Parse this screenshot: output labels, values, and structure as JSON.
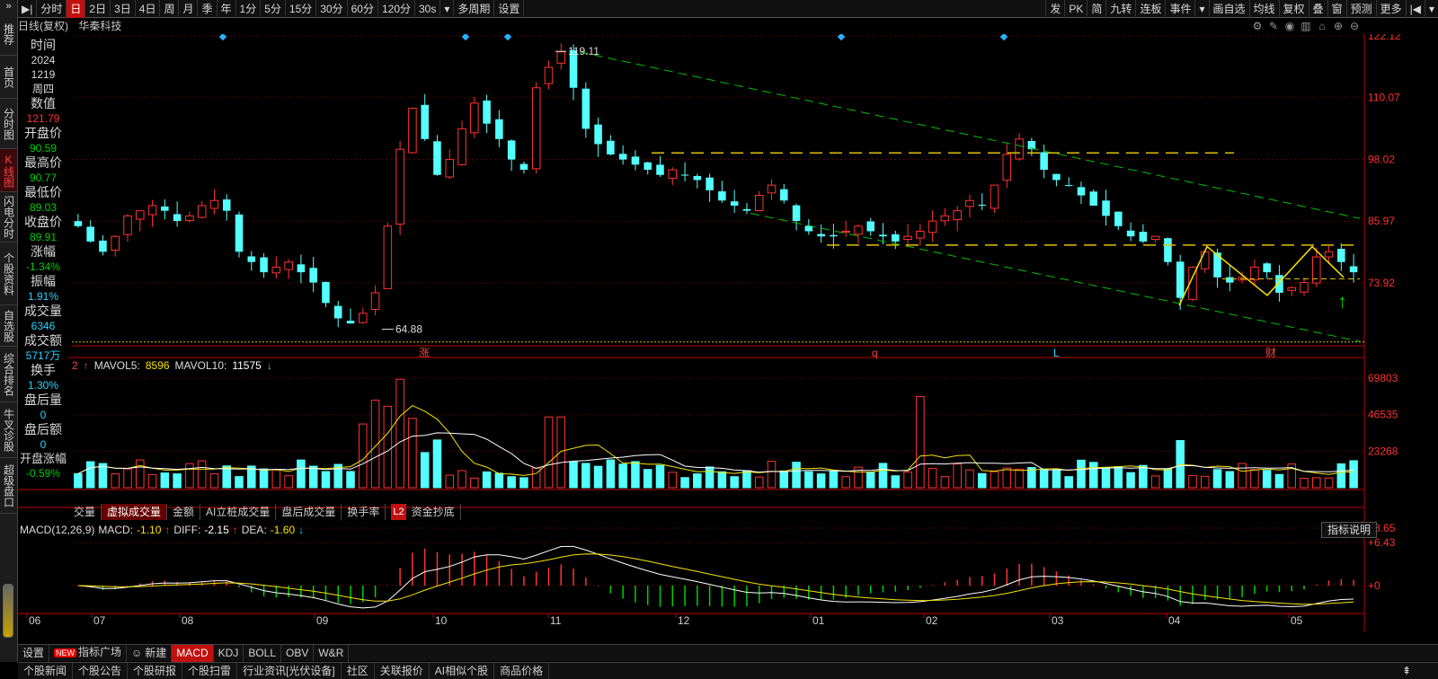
{
  "left_nav": [
    {
      "label": "推荐"
    },
    {
      "label": "首页"
    },
    {
      "label": "分时图"
    },
    {
      "label": "K线图",
      "active": true
    },
    {
      "label": "闪电分时"
    },
    {
      "label": "个股资料"
    },
    {
      "label": "自选股"
    },
    {
      "label": "综合排名"
    },
    {
      "label": "牛叉诊股"
    },
    {
      "label": "超级盘口"
    }
  ],
  "toolbar": {
    "left": [
      "分时",
      "日",
      "2日",
      "3日",
      "4日",
      "周",
      "月",
      "季",
      "年",
      "1分",
      "5分",
      "15分",
      "30分",
      "60分",
      "120分",
      "30s",
      "多周期",
      "设置"
    ],
    "active": "日",
    "right": [
      "发",
      "PK",
      "简",
      "九转",
      "连板",
      "事件",
      "画自选",
      "均线",
      "复权",
      "叠",
      "窗",
      "预测",
      "更多"
    ]
  },
  "chart_header": {
    "mode": "日线(复权)",
    "stock_name": "华秦科技"
  },
  "data_panel": [
    {
      "label": "时间",
      "values": [
        "2024",
        "1219",
        "周四"
      ],
      "color": "white"
    },
    {
      "label": "数值",
      "values": [
        "121.79"
      ],
      "color": "red"
    },
    {
      "label": "开盘价",
      "values": [
        "90.59"
      ],
      "color": "green"
    },
    {
      "label": "最高价",
      "values": [
        "90.77"
      ],
      "color": "green"
    },
    {
      "label": "最低价",
      "values": [
        "89.03"
      ],
      "color": "green"
    },
    {
      "label": "收盘价",
      "values": [
        "89.91"
      ],
      "color": "green"
    },
    {
      "label": "涨幅",
      "values": [
        "-1.34%"
      ],
      "color": "green"
    },
    {
      "label": "振幅",
      "values": [
        "1.91%"
      ],
      "color": "cyan"
    },
    {
      "label": "成交量",
      "values": [
        "6346"
      ],
      "color": "cyan"
    },
    {
      "label": "成交额",
      "values": [
        "5717万"
      ],
      "color": "cyan"
    },
    {
      "label": "换手",
      "values": [
        "1.30%"
      ],
      "color": "cyan"
    },
    {
      "label": "盘后量",
      "values": [
        "0"
      ],
      "color": "cyan"
    },
    {
      "label": "盘后额",
      "values": [
        "0"
      ],
      "color": "cyan"
    },
    {
      "label": "开盘涨幅",
      "values": [
        "-0.59%"
      ],
      "color": "green"
    }
  ],
  "price_axis": [
    "122.12",
    "110.07",
    "98.02",
    "85.97",
    "73.92"
  ],
  "volume_axis": [
    "69803",
    "46535",
    "23268"
  ],
  "macd_axis": [
    "+8.65",
    "+6.43",
    "+0"
  ],
  "date_axis": [
    "06",
    "07",
    "08",
    "09",
    "10",
    "11",
    "12",
    "01",
    "02",
    "03",
    "04",
    "05"
  ],
  "annotations": {
    "high": "119.11",
    "low": "64.88",
    "markers": [
      "涨",
      "q",
      "L",
      "财"
    ]
  },
  "volume_label": {
    "mavol5_name": "MAVOL5:",
    "mavol5": "8596",
    "mavol10_name": "MAVOL10:",
    "mavol10": "11575",
    "prefix": "2"
  },
  "indicator_tabs": [
    "交量",
    "虚拟成交量",
    "金额",
    "AI立桩成交量",
    "盘后成交量",
    "换手率"
  ],
  "indicator_tabs_active": "虚拟成交量",
  "l2_badge": "L2",
  "l2_tab": "资金抄底",
  "macd_label": {
    "name": "MACD(12,26,9)",
    "macd_name": "MACD:",
    "macd": "-1.10",
    "diff_name": "DIFF:",
    "diff": "-2.15",
    "dea_name": "DEA:",
    "dea": "-1.60"
  },
  "help_button": "指标说明",
  "indicator_bar": [
    "设置",
    "指标广场",
    "新建",
    "MACD",
    "KDJ",
    "BOLL",
    "OBV",
    "W&R"
  ],
  "indicator_bar_active": "MACD",
  "new_badge": "NEW",
  "info_tabs": [
    "个股新闻",
    "个股公告",
    "个股研报",
    "个股扫雷",
    "行业资讯[光伏设备]",
    "社区",
    "关联报价",
    "AI相似个股",
    "商品价格"
  ],
  "chart_data": {
    "type": "candlestick",
    "price_range": [
      62,
      122.12
    ],
    "high_point": 119.11,
    "low_point": 64.88,
    "close_series": [
      85,
      82,
      80,
      83,
      87,
      88,
      89,
      88,
      86,
      87,
      89,
      90,
      88,
      80,
      78,
      76,
      77,
      78,
      76,
      74,
      70,
      67,
      66,
      68,
      72,
      85,
      100,
      108,
      102,
      95,
      98,
      104,
      109,
      105,
      102,
      98,
      96,
      112,
      116,
      119,
      112,
      104,
      101,
      99,
      98,
      97,
      96,
      95,
      96,
      95,
      94,
      92,
      90,
      89,
      88,
      91,
      93,
      90,
      86,
      84,
      83,
      83,
      84,
      85,
      84,
      83,
      82,
      83,
      84,
      86,
      87,
      88,
      90,
      89,
      93,
      99,
      102,
      100,
      96,
      94,
      93,
      91,
      89,
      87,
      85,
      83,
      82,
      83,
      78,
      71,
      77,
      80,
      75,
      74,
      75,
      77,
      76,
      72,
      73,
      74,
      79,
      80,
      78,
      76
    ]
  }
}
